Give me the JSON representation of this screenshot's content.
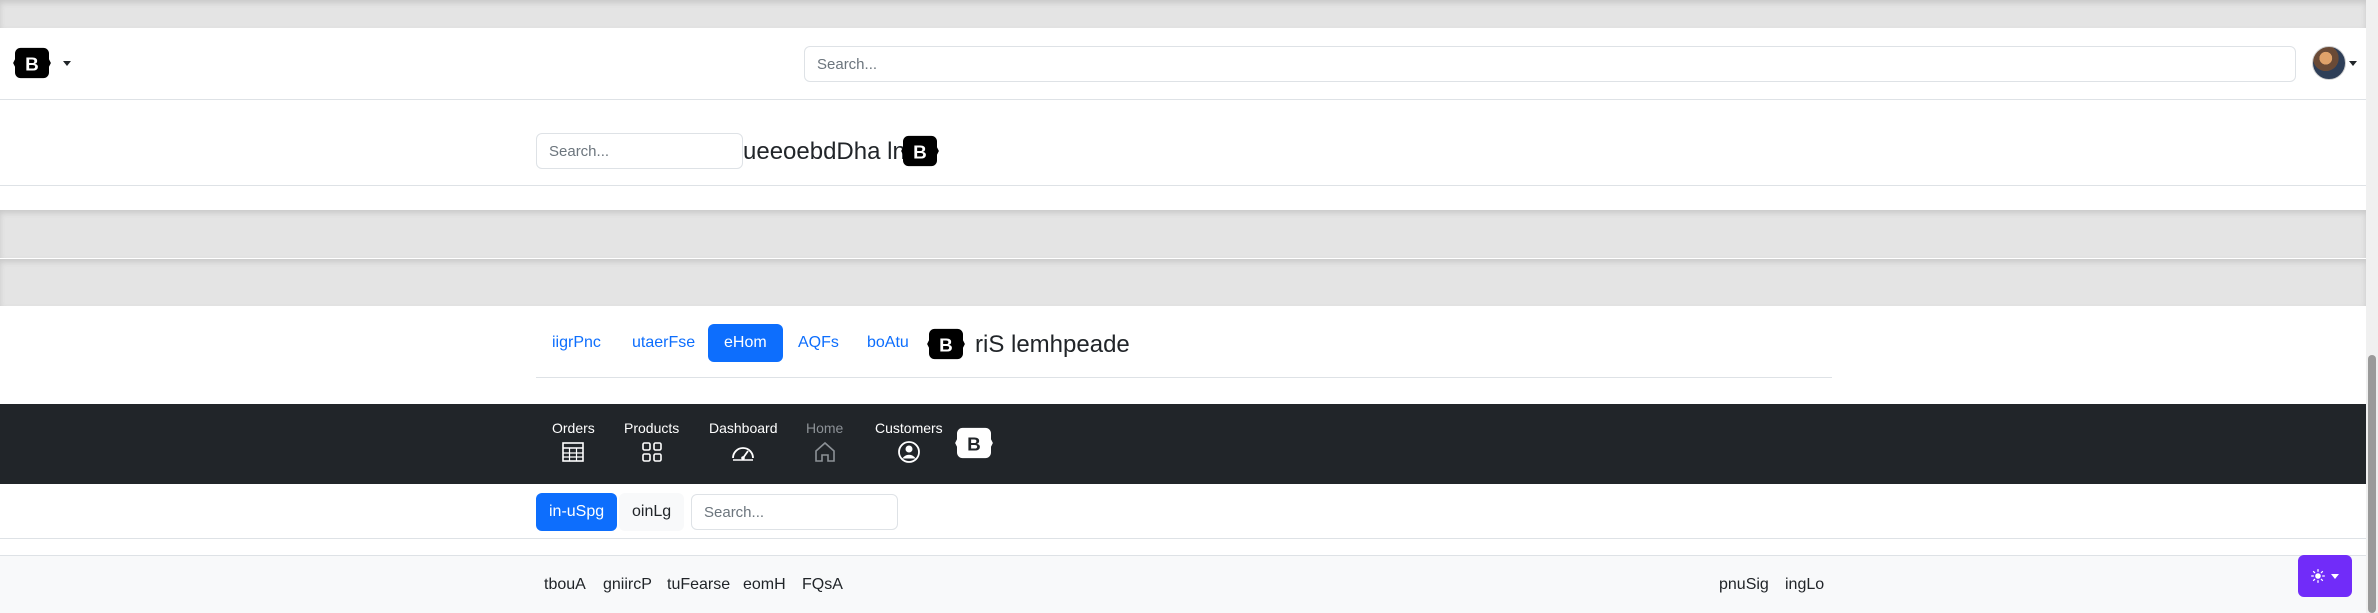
{
  "header1": {
    "search_placeholder": "Search..."
  },
  "header2": {
    "search_placeholder": "Search...",
    "brand_text": "ueeoebdDha ln"
  },
  "header3": {
    "pills": [
      {
        "label": "iigrPnc",
        "active": false
      },
      {
        "label": "utaerFse",
        "active": false
      },
      {
        "label": "eHom",
        "active": true
      },
      {
        "label": "AQFs",
        "active": false
      },
      {
        "label": "boAtu",
        "active": false
      }
    ],
    "brand_text": "riS lemhpeade"
  },
  "darknav": {
    "items": [
      {
        "label": "Orders",
        "icon": "table-icon",
        "muted": false
      },
      {
        "label": "Products",
        "icon": "grid-icon",
        "muted": false
      },
      {
        "label": "Dashboard",
        "icon": "speedometer-icon",
        "muted": false
      },
      {
        "label": "Home",
        "icon": "house-icon",
        "muted": true
      },
      {
        "label": "Customers",
        "icon": "person-circle-icon",
        "muted": false
      }
    ]
  },
  "toolbar": {
    "signup_label": "in-uSpg",
    "login_label": "oinLg",
    "search_placeholder": "Search..."
  },
  "footer": {
    "links_left": [
      "tbouA",
      "gniircP",
      "tuFearse",
      "eomH",
      "FQsA"
    ],
    "links_right": [
      "pnuSig",
      "ingLo"
    ]
  },
  "colors": {
    "primary": "#0d6efd",
    "dark": "#212529",
    "theme_button": "#712cf9"
  }
}
